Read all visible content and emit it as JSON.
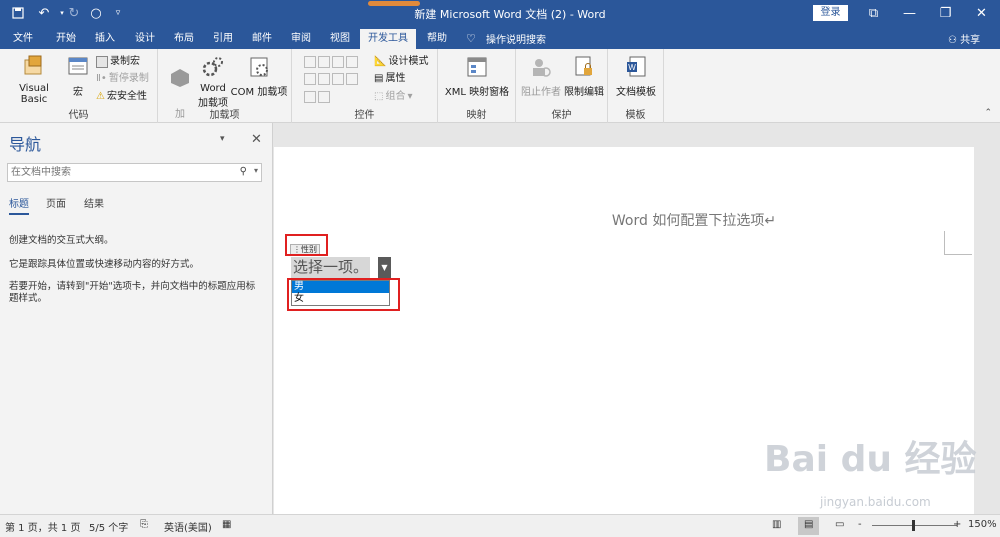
{
  "titlebar": {
    "title": "新建 Microsoft Word 文档 (2)  -  Word",
    "login_label": "登录",
    "save_icon": "save-icon",
    "undo_icon": "undo-icon",
    "redo_icon": "redo-icon",
    "circle_icon": "circle-icon",
    "customize_icon": "customize-icon"
  },
  "tabs": [
    {
      "label": "文件"
    },
    {
      "label": "开始"
    },
    {
      "label": "插入"
    },
    {
      "label": "设计"
    },
    {
      "label": "布局"
    },
    {
      "label": "引用"
    },
    {
      "label": "邮件"
    },
    {
      "label": "审阅"
    },
    {
      "label": "视图"
    },
    {
      "label": "开发工具"
    },
    {
      "label": "帮助"
    }
  ],
  "tell_me": "操作说明搜索",
  "share": "共享",
  "ribbon": {
    "code": {
      "label": "代码",
      "visual_basic": "Visual Basic",
      "macro": "宏",
      "record_macro": "录制宏",
      "pause_record": "暂停录制",
      "macro_security": "宏安全性"
    },
    "addins": {
      "label": "加载项",
      "addin": "加\n载项",
      "word_addin_1": "Word",
      "word_addin_2": "加载项",
      "com_addin": "COM 加载项"
    },
    "controls": {
      "label": "控件",
      "design_mode": "设计模式",
      "properties": "属性",
      "group": "组合"
    },
    "mapping": {
      "label": "映射",
      "xml_pane": "XML 映射窗格"
    },
    "protect": {
      "label": "保护",
      "block_authors": "阻止作者",
      "restrict_editing": "限制编辑"
    },
    "templates": {
      "label": "模板",
      "doc_template": "文档模板"
    }
  },
  "nav": {
    "title": "导航",
    "search_placeholder": "在文档中搜索",
    "tabs": [
      "标题",
      "页面",
      "结果"
    ],
    "text1": "创建文档的交互式大纲。",
    "text2": "它是跟踪具体位置或快速移动内容的好方式。",
    "text3": "若要开始，请转到\"开始\"选项卡，并向文档中的标题应用标题样式。"
  },
  "document": {
    "heading": "Word 如何配置下拉选项↵",
    "cc_tag": "性别",
    "cc_placeholder": "选择一项。",
    "options": [
      "男",
      "女"
    ]
  },
  "status": {
    "page": "第 1 页，共 1 页",
    "words": "5/5 个字",
    "language": "英语(美国)",
    "zoom": "150%",
    "minus": "-",
    "plus": "+"
  },
  "watermark": {
    "main": "Bai du 经验",
    "sub": "jingyan.baidu.com"
  },
  "colors": {
    "brand": "#2b579a",
    "highlight": "#0078d7",
    "annotation": "#e02020"
  }
}
